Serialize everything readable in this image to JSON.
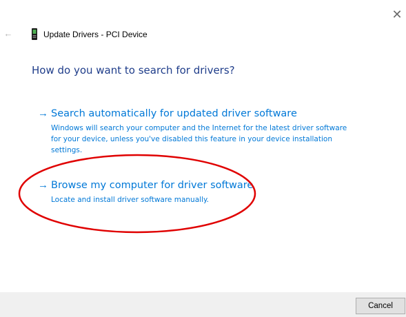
{
  "window": {
    "title": "Update Drivers - PCI Device",
    "close_glyph": "✕",
    "back_glyph": "←",
    "icons": {
      "close": "close-icon",
      "back": "back-arrow-icon",
      "device": "device-icon"
    }
  },
  "main": {
    "question": "How do you want to search for drivers?",
    "options": [
      {
        "arrow": "→",
        "title": "Search automatically for updated driver software",
        "description": "Windows will search your computer and the Internet for the latest driver software for your device, unless you've disabled this feature in your device installation settings."
      },
      {
        "arrow": "→",
        "title": "Browse my computer for driver software",
        "description": "Locate and install driver software manually.",
        "highlighted": true
      }
    ]
  },
  "footer": {
    "cancel_label": "Cancel"
  },
  "colors": {
    "link": "#0078d7",
    "heading": "#1f3d8a",
    "annotation": "#e00000",
    "footer_bg": "#f0f0f0"
  }
}
